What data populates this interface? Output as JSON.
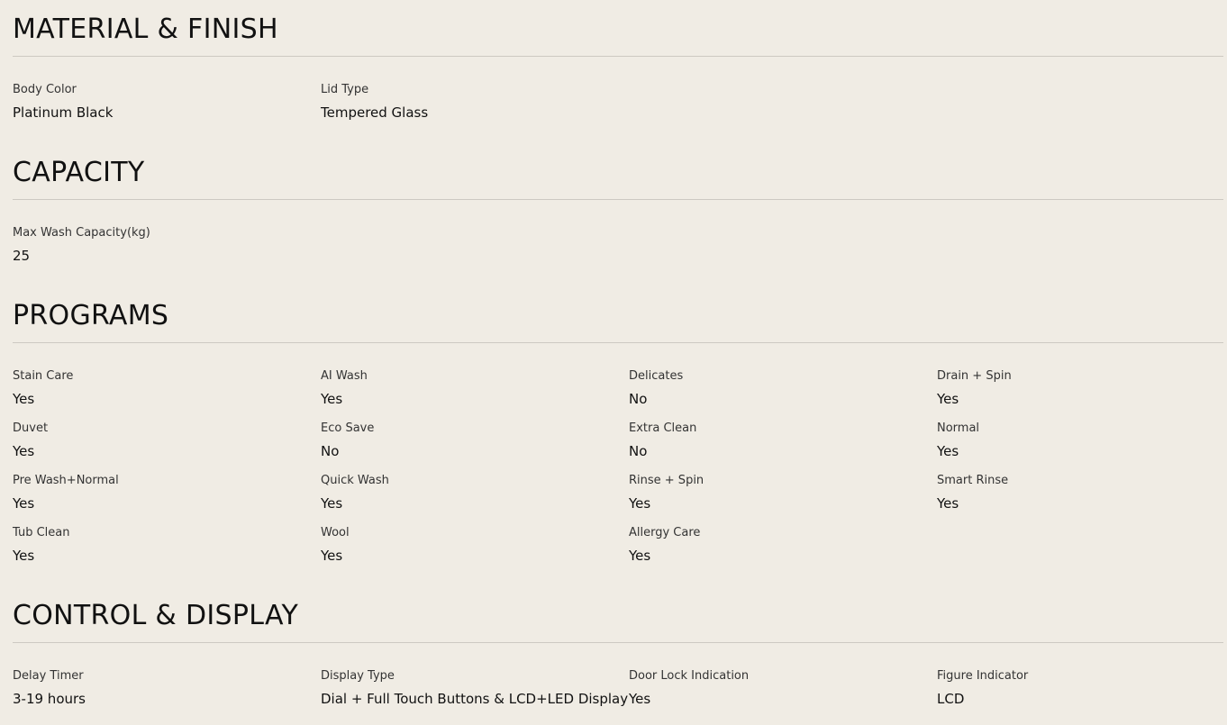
{
  "sections": [
    {
      "title": "MATERIAL & FINISH",
      "specs": [
        {
          "label": "Body Color",
          "value": "Platinum Black"
        },
        {
          "label": "Lid Type",
          "value": "Tempered Glass"
        }
      ]
    },
    {
      "title": "CAPACITY",
      "specs": [
        {
          "label": "Max Wash Capacity(kg)",
          "value": "25"
        }
      ]
    },
    {
      "title": "PROGRAMS",
      "specs": [
        {
          "label": "Stain Care",
          "value": "Yes"
        },
        {
          "label": "AI Wash",
          "value": "Yes"
        },
        {
          "label": "Delicates",
          "value": "No"
        },
        {
          "label": "Drain + Spin",
          "value": "Yes"
        },
        {
          "label": "Duvet",
          "value": "Yes"
        },
        {
          "label": "Eco Save",
          "value": "No"
        },
        {
          "label": "Extra Clean",
          "value": "No"
        },
        {
          "label": "Normal",
          "value": "Yes"
        },
        {
          "label": "Pre Wash+Normal",
          "value": "Yes"
        },
        {
          "label": "Quick Wash",
          "value": "Yes"
        },
        {
          "label": "Rinse + Spin",
          "value": "Yes"
        },
        {
          "label": "Smart Rinse",
          "value": "Yes"
        },
        {
          "label": "Tub Clean",
          "value": "Yes"
        },
        {
          "label": "Wool",
          "value": "Yes"
        },
        {
          "label": "Allergy Care",
          "value": "Yes"
        }
      ]
    },
    {
      "title": "CONTROL & DISPLAY",
      "specs": [
        {
          "label": "Delay Timer",
          "value": "3-19 hours"
        },
        {
          "label": "Display Type",
          "value": "Dial + Full Touch Buttons & LCD+LED Display"
        },
        {
          "label": "Door Lock Indication",
          "value": "Yes"
        },
        {
          "label": "Figure Indicator",
          "value": "LCD"
        }
      ]
    }
  ],
  "colors": {
    "background": "#f0ece4",
    "text": "#111111",
    "label": "#333333",
    "divider": "#cdc9c2"
  }
}
